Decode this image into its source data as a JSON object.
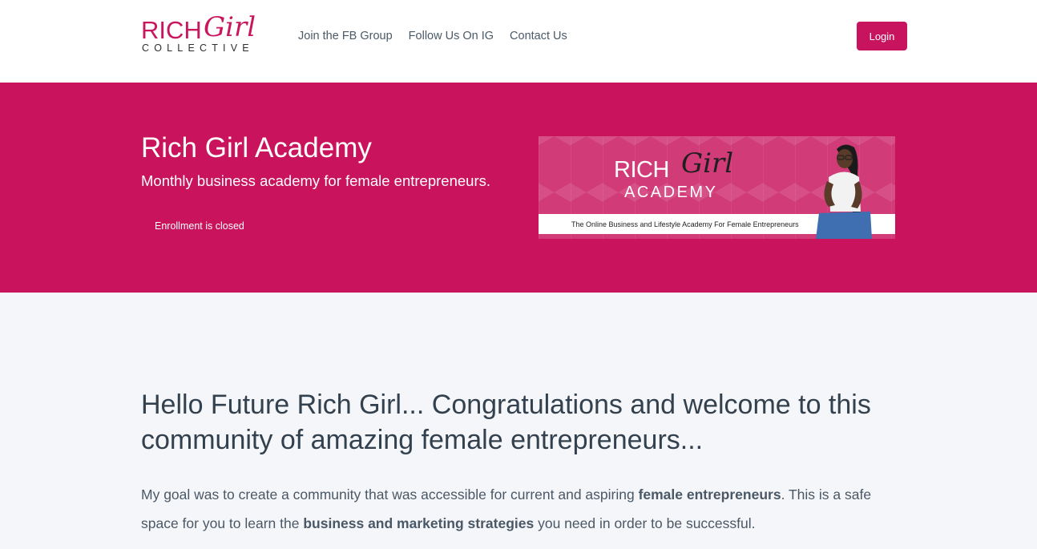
{
  "header": {
    "logo": {
      "rich": "RICH",
      "girl": "Girl",
      "collective": "COLLECTIVE"
    },
    "nav": [
      {
        "label": "Join the FB Group"
      },
      {
        "label": "Follow Us On IG"
      },
      {
        "label": "Contact Us"
      }
    ],
    "login_label": "Login"
  },
  "hero": {
    "title": "Rich Girl Academy",
    "subtitle": "Monthly business academy for female entrepreneurs.",
    "status": "Enrollment is closed",
    "banner": {
      "rich": "RICH",
      "girl": "Girl",
      "academy": "ACADEMY",
      "tagline": "The Online Business and Lifestyle Academy For Female Entrepreneurs"
    }
  },
  "content": {
    "heading": "Hello Future Rich Girl... Congratulations and welcome to this community of amazing female entrepreneurs...",
    "para1_a": "My goal was to create a community that was accessible for current and aspiring ",
    "para1_b": "female entrepreneurs",
    "para1_c": ".  This is a safe space for you to learn the ",
    "para1_d": "business and marketing strategies",
    "para1_e": " you need in order to be successful."
  },
  "colors": {
    "brand": "#c9135c",
    "login_button": "#c8135e",
    "page_bg": "#f5f6fa",
    "text": "#33414e"
  }
}
